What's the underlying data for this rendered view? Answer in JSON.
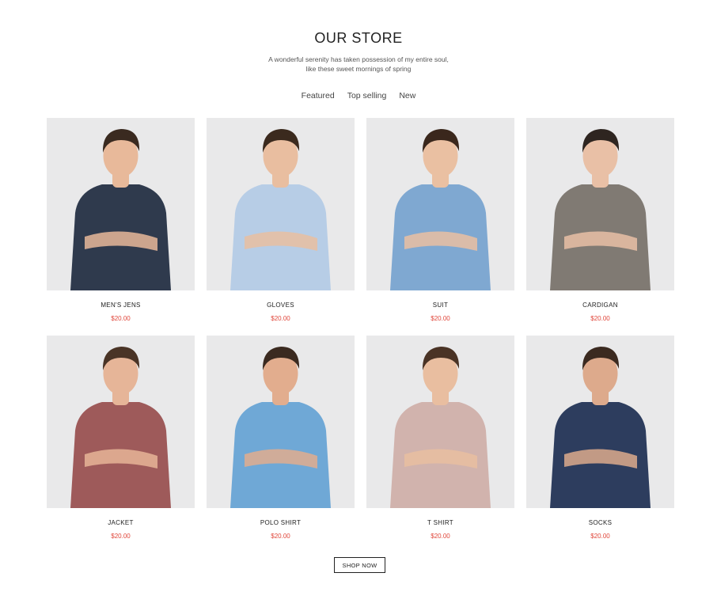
{
  "store": {
    "title": "OUR STORE",
    "subtitle_line1": "A wonderful serenity has taken possession of my entire soul,",
    "subtitle_line2": "like these sweet mornings of spring"
  },
  "tabs": [
    {
      "label": "Featured"
    },
    {
      "label": "Top selling"
    },
    {
      "label": "New"
    }
  ],
  "products": [
    {
      "name": "MEN'S JENS",
      "price": "$20.00",
      "shirt_color": "#2f3a4d",
      "skin": "#e8b99a",
      "hair": "#3a2a20"
    },
    {
      "name": "GLOVES",
      "price": "$20.00",
      "shirt_color": "#b7cde6",
      "skin": "#e9bea0",
      "hair": "#3b2a1e"
    },
    {
      "name": "SUIT",
      "price": "$20.00",
      "shirt_color": "#7fa8d1",
      "skin": "#eac0a2",
      "hair": "#3a271c"
    },
    {
      "name": "CARDIGAN",
      "price": "$20.00",
      "shirt_color": "#807a73",
      "skin": "#e9c0a6",
      "hair": "#2e2520"
    },
    {
      "name": "JACKET",
      "price": "$20.00",
      "shirt_color": "#9e5a5a",
      "skin": "#e6b598",
      "hair": "#4a3426"
    },
    {
      "name": "POLO SHIRT",
      "price": "$20.00",
      "shirt_color": "#6fa8d6",
      "skin": "#e2ad8e",
      "hair": "#3b2a20"
    },
    {
      "name": "T SHIRT",
      "price": "$20.00",
      "shirt_color": "#d1b3ad",
      "skin": "#e9bea0",
      "hair": "#4a3325"
    },
    {
      "name": "SOCKS",
      "price": "$20.00",
      "shirt_color": "#2d3d5e",
      "skin": "#ddaa8c",
      "hair": "#3b2a20"
    }
  ],
  "shop_button": {
    "label": "SHOP NOW"
  },
  "colors": {
    "accent_price": "#e0463a",
    "photo_bg": "#e9e9ea"
  }
}
